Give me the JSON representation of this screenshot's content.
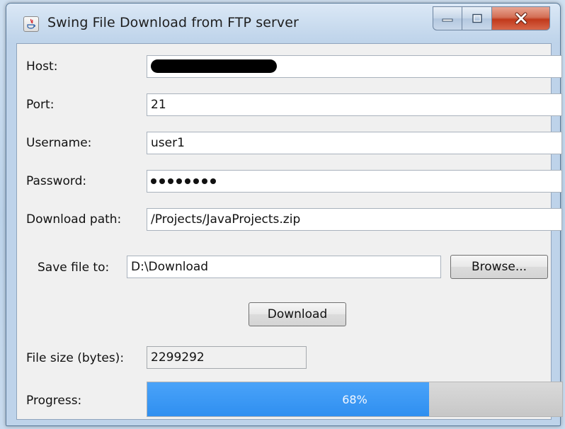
{
  "window": {
    "title": "Swing File Download from FTP server",
    "controls": {
      "minimize_icon": "minimize-icon",
      "maximize_icon": "maximize-icon",
      "close_icon": "close-icon"
    }
  },
  "form": {
    "host": {
      "label": "Host:",
      "value": ""
    },
    "port": {
      "label": "Port:",
      "value": "21"
    },
    "username": {
      "label": "Username:",
      "value": "user1"
    },
    "password": {
      "label": "Password:",
      "masked_length": 8
    },
    "download_path": {
      "label": "Download path:",
      "value": "/Projects/JavaProjects.zip"
    },
    "save_to": {
      "label": "Save file to:",
      "value": "D:\\Download",
      "browse_label": "Browse..."
    },
    "download_button": "Download",
    "file_size": {
      "label": "File size (bytes):",
      "value": "2299292"
    },
    "progress": {
      "label": "Progress:",
      "percent": 68,
      "text": "68%"
    }
  },
  "colors": {
    "progress_fill": "#2f8ff0",
    "close_button": "#c1391b",
    "window_frame": "#bed3ea"
  }
}
